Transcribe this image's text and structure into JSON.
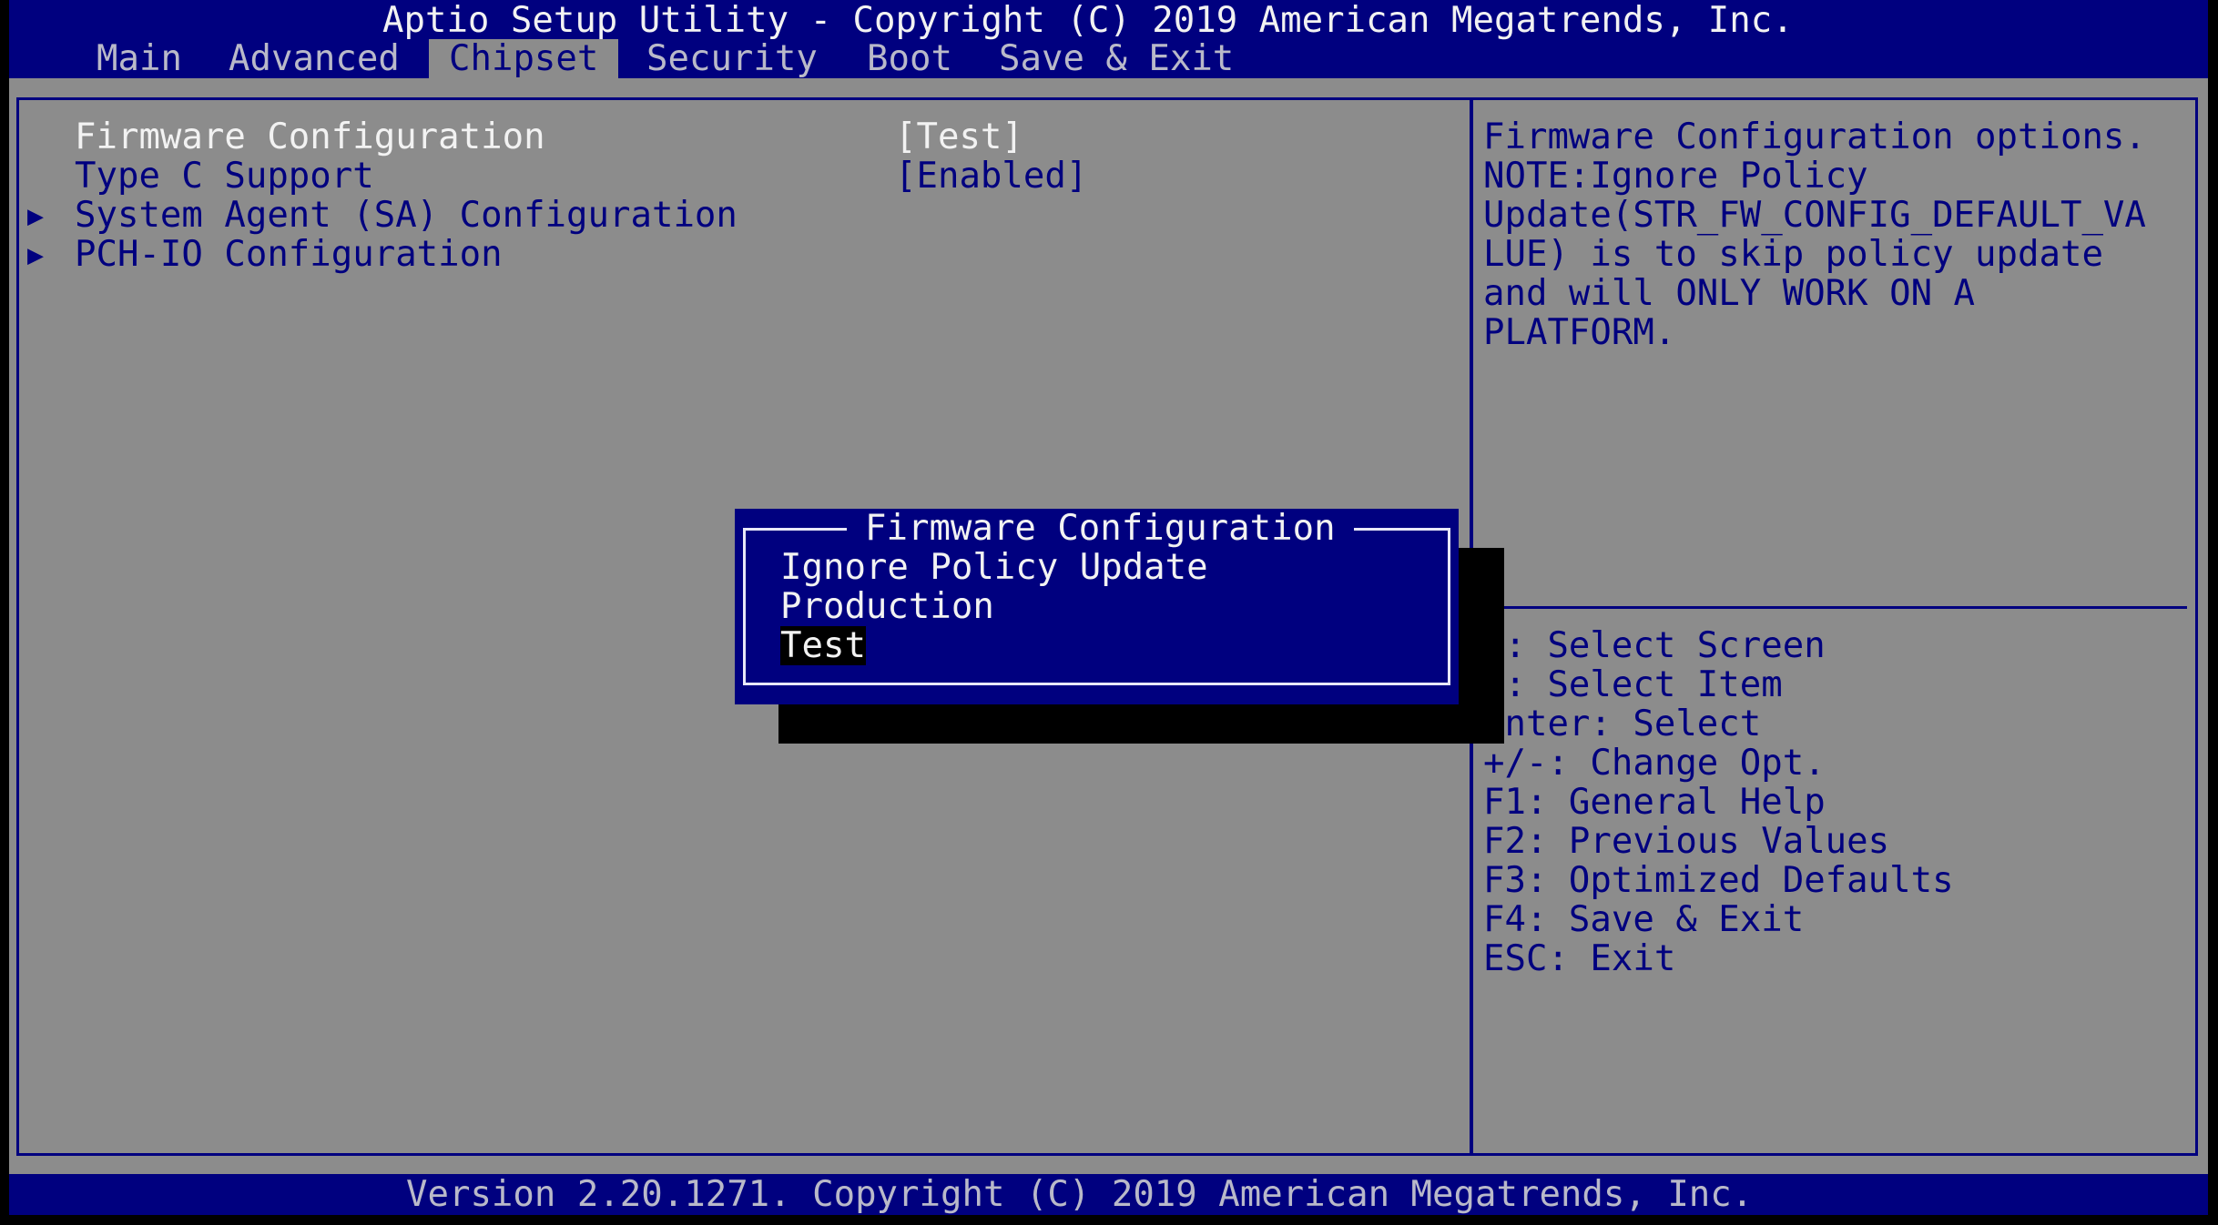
{
  "header": {
    "title": "Aptio Setup Utility - Copyright (C) 2019 American Megatrends, Inc.",
    "tabs": [
      {
        "label": "Main",
        "active": false
      },
      {
        "label": "Advanced",
        "active": false
      },
      {
        "label": "Chipset",
        "active": true
      },
      {
        "label": "Security",
        "active": false
      },
      {
        "label": "Boot",
        "active": false
      },
      {
        "label": "Save & Exit",
        "active": false
      }
    ]
  },
  "settings": {
    "items": [
      {
        "label": "Firmware Configuration",
        "value": "[Test]",
        "submenu": false,
        "selected": true
      },
      {
        "label": "Type C Support",
        "value": "[Enabled]",
        "submenu": false,
        "selected": false
      },
      {
        "label": "System Agent (SA) Configuration",
        "value": "",
        "submenu": true,
        "submenu_icon": "▶",
        "selected": false
      },
      {
        "label": "PCH-IO Configuration",
        "value": "",
        "submenu": true,
        "submenu_icon": "▶",
        "selected": false
      }
    ]
  },
  "help": {
    "description_lines": [
      "Firmware Configuration options.",
      "NOTE:Ignore Policy",
      "Update(STR_FW_CONFIG_DEFAULT_VA",
      "LUE) is to skip policy update",
      "and will ONLY WORK ON A",
      "PLATFORM."
    ],
    "keys": [
      "←: Select Screen",
      "↓: Select Item",
      "Enter: Select",
      "+/-: Change Opt.",
      "F1: General Help",
      "F2: Previous Values",
      "F3: Optimized Defaults",
      "F4: Save & Exit",
      "ESC: Exit"
    ]
  },
  "popup": {
    "title": "Firmware Configuration",
    "options": [
      {
        "label": "Ignore Policy Update",
        "selected": false
      },
      {
        "label": "Production",
        "selected": false
      },
      {
        "label": "Test",
        "selected": true
      }
    ]
  },
  "footer": {
    "text": "Version 2.20.1271. Copyright (C) 2019 American Megatrends, Inc."
  },
  "colors": {
    "bios_blue": "#00007f",
    "bios_gray": "#8c8c8c",
    "highlight_text": "#f2f2f2",
    "selection_background": "#000000"
  }
}
